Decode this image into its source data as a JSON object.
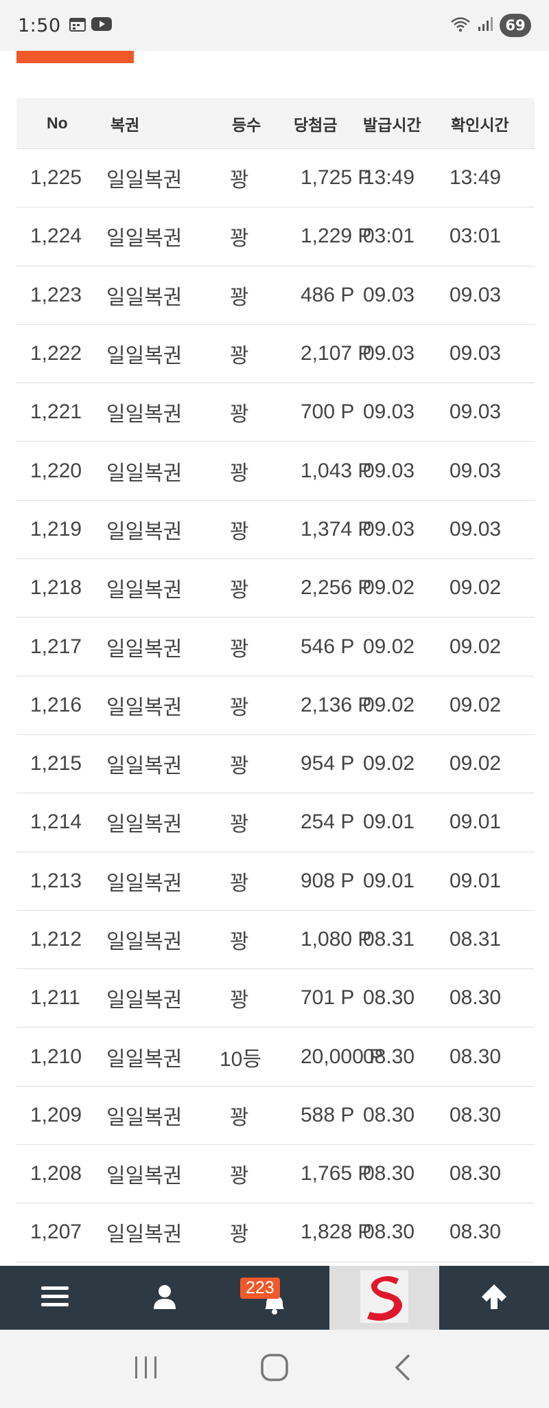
{
  "status_bar": {
    "time": "1:50",
    "battery": "69",
    "icons": [
      "calendar-icon",
      "youtube-icon",
      "wifi-icon",
      "signal-icon"
    ]
  },
  "colors": {
    "accent": "#f1582a",
    "nav_bg": "#2d3943",
    "header_bg": "#f4f4f4"
  },
  "table": {
    "headers": {
      "no": "No",
      "type": "복권",
      "rank": "등수",
      "prize": "당첨금",
      "issued": "발급시간",
      "checked": "확인시간"
    },
    "rows": [
      {
        "no": "1,225",
        "type": "일일복권",
        "rank": "꽝",
        "prize": "1,725 P",
        "issued": "13:49",
        "checked": "13:49"
      },
      {
        "no": "1,224",
        "type": "일일복권",
        "rank": "꽝",
        "prize": "1,229 P",
        "issued": "03:01",
        "checked": "03:01"
      },
      {
        "no": "1,223",
        "type": "일일복권",
        "rank": "꽝",
        "prize": "486 P",
        "issued": "09.03",
        "checked": "09.03"
      },
      {
        "no": "1,222",
        "type": "일일복권",
        "rank": "꽝",
        "prize": "2,107 P",
        "issued": "09.03",
        "checked": "09.03"
      },
      {
        "no": "1,221",
        "type": "일일복권",
        "rank": "꽝",
        "prize": "700 P",
        "issued": "09.03",
        "checked": "09.03"
      },
      {
        "no": "1,220",
        "type": "일일복권",
        "rank": "꽝",
        "prize": "1,043 P",
        "issued": "09.03",
        "checked": "09.03"
      },
      {
        "no": "1,219",
        "type": "일일복권",
        "rank": "꽝",
        "prize": "1,374 P",
        "issued": "09.03",
        "checked": "09.03"
      },
      {
        "no": "1,218",
        "type": "일일복권",
        "rank": "꽝",
        "prize": "2,256 P",
        "issued": "09.02",
        "checked": "09.02"
      },
      {
        "no": "1,217",
        "type": "일일복권",
        "rank": "꽝",
        "prize": "546 P",
        "issued": "09.02",
        "checked": "09.02"
      },
      {
        "no": "1,216",
        "type": "일일복권",
        "rank": "꽝",
        "prize": "2,136 P",
        "issued": "09.02",
        "checked": "09.02"
      },
      {
        "no": "1,215",
        "type": "일일복권",
        "rank": "꽝",
        "prize": "954 P",
        "issued": "09.02",
        "checked": "09.02"
      },
      {
        "no": "1,214",
        "type": "일일복권",
        "rank": "꽝",
        "prize": "254 P",
        "issued": "09.01",
        "checked": "09.01"
      },
      {
        "no": "1,213",
        "type": "일일복권",
        "rank": "꽝",
        "prize": "908 P",
        "issued": "09.01",
        "checked": "09.01"
      },
      {
        "no": "1,212",
        "type": "일일복권",
        "rank": "꽝",
        "prize": "1,080 P",
        "issued": "08.31",
        "checked": "08.31"
      },
      {
        "no": "1,211",
        "type": "일일복권",
        "rank": "꽝",
        "prize": "701 P",
        "issued": "08.30",
        "checked": "08.30"
      },
      {
        "no": "1,210",
        "type": "일일복권",
        "rank": "10등",
        "prize": "20,000 P",
        "issued": "08.30",
        "checked": "08.30"
      },
      {
        "no": "1,209",
        "type": "일일복권",
        "rank": "꽝",
        "prize": "588 P",
        "issued": "08.30",
        "checked": "08.30"
      },
      {
        "no": "1,208",
        "type": "일일복권",
        "rank": "꽝",
        "prize": "1,765 P",
        "issued": "08.30",
        "checked": "08.30"
      },
      {
        "no": "1,207",
        "type": "일일복권",
        "rank": "꽝",
        "prize": "1,828 P",
        "issued": "08.30",
        "checked": "08.30"
      }
    ]
  },
  "bottom_nav": {
    "notification_count": "223",
    "icons": [
      "menu-icon",
      "user-icon",
      "bell-icon",
      "site-logo",
      "arrow-up-icon"
    ]
  },
  "system_nav": {
    "icons": [
      "recent-apps-icon",
      "home-icon",
      "back-icon"
    ]
  }
}
